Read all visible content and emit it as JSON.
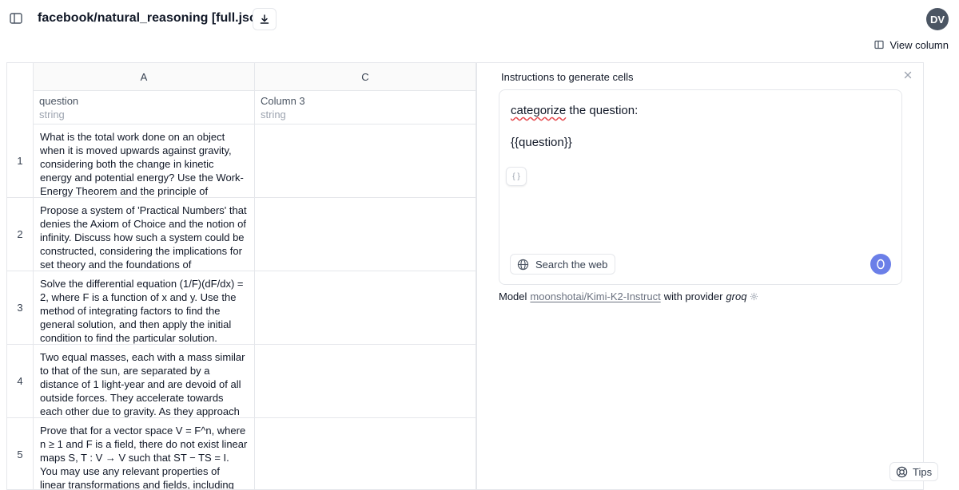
{
  "header": {
    "title": "facebook/natural_reasoning [full.jsonl]",
    "avatar_initials": "DV",
    "view_column_label": "View column"
  },
  "table": {
    "columns": [
      {
        "letter": "A",
        "name": "question",
        "type": "string"
      },
      {
        "letter": "C",
        "name": "Column 3",
        "type": "string"
      }
    ],
    "rows": [
      {
        "num": "1",
        "question": "What is the total work done on an object when it is moved upwards against gravity, considering both the change in kinetic energy and potential energy? Use the Work-Energy Theorem and the principle of conservation of",
        "col3": ""
      },
      {
        "num": "2",
        "question": "Propose a system of 'Practical Numbers' that denies the Axiom of Choice and the notion of infinity. Discuss how such a system could be constructed, considering the implications for set theory and the foundations of mathematics",
        "col3": ""
      },
      {
        "num": "3",
        "question": "Solve the differential equation (1/F)(dF/dx) = 2, where F is a function of x and y. Use the method of integrating factors to find the general solution, and then apply the initial condition to find the particular solution.",
        "col3": ""
      },
      {
        "num": "4",
        "question": "Two equal masses, each with a mass similar to that of the sun, are separated by a distance of 1 light-year and are devoid of all outside forces. They accelerate towards each other due to gravity. As they approach each other, their",
        "col3": ""
      },
      {
        "num": "5",
        "question": "Prove that for a vector space V = F^n, where n ≥ 1 and F is a field, there do not exist linear maps S, T : V → V such that ST − TS = I. You may use any relevant properties of linear transformations and fields, including the",
        "col3": ""
      }
    ]
  },
  "panel": {
    "title": "Instructions to generate cells",
    "prompt_word": "categorize",
    "prompt_rest": " the question:",
    "prompt_variable": "{{question}}",
    "braces_label": "{ }",
    "search_web_label": "Search the web",
    "model_prefix": "Model",
    "model_name": "moonshotai/Kimi-K2-Instruct",
    "provider_prefix": "with provider",
    "provider_name": "groq"
  },
  "tips_label": "Tips"
}
